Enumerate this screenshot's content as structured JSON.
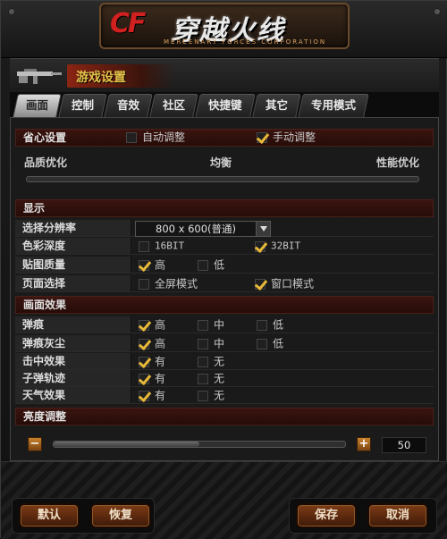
{
  "banner": {
    "logo_mark": "CF",
    "title": "穿越火线",
    "subtitle": "MERCENARY  FORCES  CORPORATION"
  },
  "window": {
    "title": "游戏设置",
    "title_icon": "rifle-icon"
  },
  "tabs": [
    {
      "label": "画面",
      "active": true
    },
    {
      "label": "控制"
    },
    {
      "label": "音效"
    },
    {
      "label": "社区"
    },
    {
      "label": "快捷键"
    },
    {
      "label": "其它"
    },
    {
      "label": "专用模式"
    }
  ],
  "preset": {
    "label": "省心设置",
    "auto": {
      "label": "自动调整",
      "checked": false
    },
    "manual": {
      "label": "手动调整",
      "checked": true
    },
    "quality_left": "品质优化",
    "quality_mid": "均衡",
    "quality_right": "性能优化"
  },
  "display": {
    "header": "显示",
    "resolution": {
      "label": "选择分辨率",
      "value": "800 x 600(普通)"
    },
    "color_depth": {
      "label": "色彩深度",
      "options": [
        {
          "label": "16BIT",
          "checked": false
        },
        {
          "label": "32BIT",
          "checked": true
        }
      ]
    },
    "texture": {
      "label": "贴图质量",
      "options": [
        {
          "label": "高",
          "checked": true
        },
        {
          "label": "低",
          "checked": false
        }
      ]
    },
    "screen_mode": {
      "label": "页面选择",
      "options": [
        {
          "label": "全屏模式",
          "checked": false
        },
        {
          "label": "窗口模式",
          "checked": true
        }
      ]
    }
  },
  "effects": {
    "header": "画面效果",
    "rows": [
      {
        "label": "弹痕",
        "options": [
          {
            "label": "高",
            "checked": true
          },
          {
            "label": "中",
            "checked": false
          },
          {
            "label": "低",
            "checked": false
          }
        ]
      },
      {
        "label": "弹痕灰尘",
        "options": [
          {
            "label": "高",
            "checked": true
          },
          {
            "label": "中",
            "checked": false
          },
          {
            "label": "低",
            "checked": false
          }
        ]
      },
      {
        "label": "击中效果",
        "options": [
          {
            "label": "有",
            "checked": true
          },
          {
            "label": "无",
            "checked": false
          }
        ]
      },
      {
        "label": "子弹轨迹",
        "options": [
          {
            "label": "有",
            "checked": true
          },
          {
            "label": "无",
            "checked": false
          }
        ]
      },
      {
        "label": "天气效果",
        "options": [
          {
            "label": "有",
            "checked": true
          },
          {
            "label": "无",
            "checked": false
          }
        ]
      }
    ]
  },
  "brightness": {
    "header": "亮度调整",
    "minus": "−",
    "plus": "+",
    "value": "50",
    "fill_fraction": 0.5
  },
  "buttons": {
    "default": "默认",
    "restore": "恢复",
    "save": "保存",
    "cancel": "取消"
  },
  "colors": {
    "accent_gold": "#e8b838",
    "section_red": "#3a1410",
    "button_brown": "#7c3b16"
  }
}
